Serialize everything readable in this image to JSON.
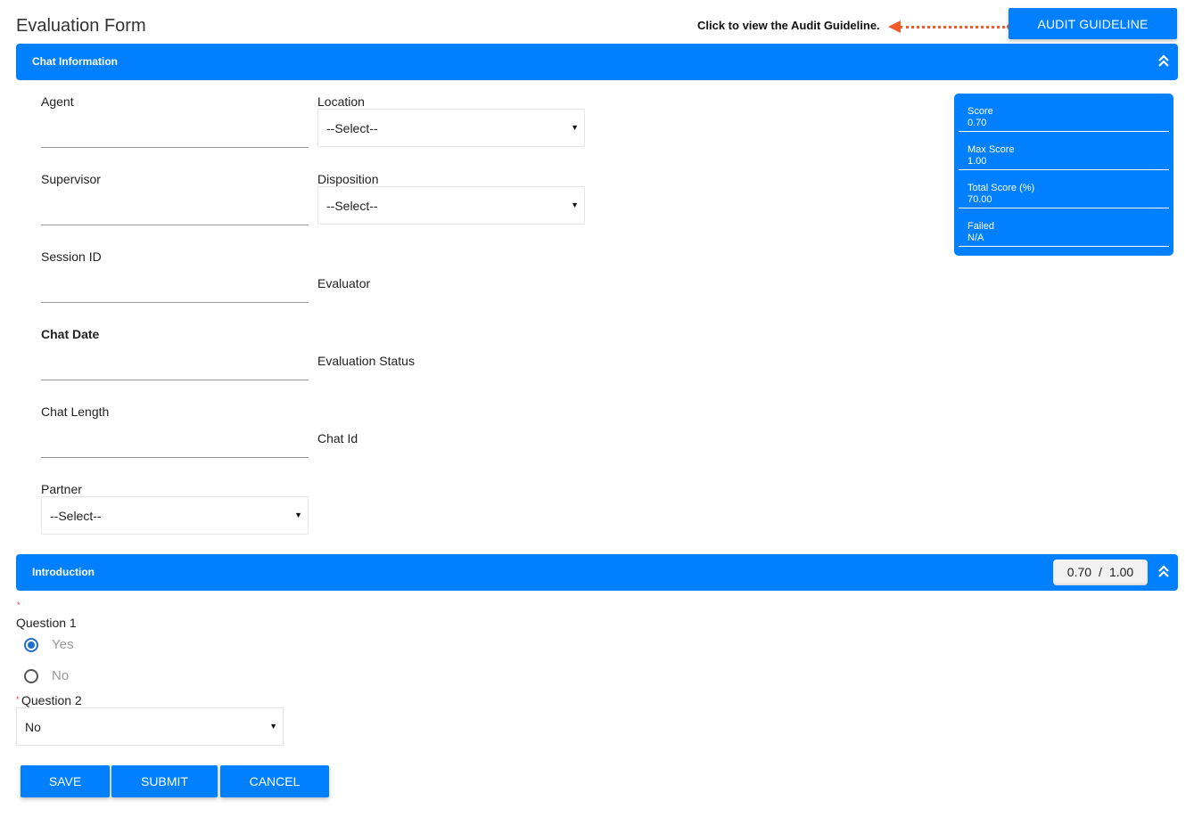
{
  "page": {
    "title": "Evaluation Form",
    "hint_text": "Click to view the Audit Guideline.",
    "audit_button_label": "AUDIT GUIDELINE",
    "accent_color": "#0080ff",
    "hint_color": "#f05a28"
  },
  "chat_information": {
    "title": "Chat Information",
    "left_fields": [
      {
        "label": "Agent",
        "value": ""
      },
      {
        "label": "Supervisor",
        "value": ""
      },
      {
        "label": "Session ID",
        "value": ""
      },
      {
        "label": "Chat Date",
        "value": ""
      },
      {
        "label": "Chat Length",
        "value": ""
      }
    ],
    "partner": {
      "label": "Partner",
      "value": "--Select--"
    },
    "location": {
      "label": "Location",
      "value": "--Select--"
    },
    "disposition": {
      "label": "Disposition",
      "value": "--Select--"
    },
    "evaluator": {
      "label": "Evaluator",
      "value": ""
    },
    "evaluation_status": {
      "label": "Evaluation Status",
      "value": ""
    },
    "chat_id": {
      "label": "Chat Id",
      "value": ""
    }
  },
  "score_card": [
    {
      "label": "Score",
      "value": "0.70"
    },
    {
      "label": "Max Score",
      "value": "1.00"
    },
    {
      "label": "Total Score (%)",
      "value": "70.00"
    },
    {
      "label": "Failed",
      "value": "N/A"
    }
  ],
  "introduction": {
    "title": "Introduction",
    "score": "0.70",
    "separator": "/",
    "max_score": "1.00",
    "question1": {
      "required_mark": "*",
      "label": "Question 1",
      "options": [
        {
          "label": "Yes",
          "checked": true
        },
        {
          "label": "No",
          "checked": false
        }
      ]
    },
    "question2": {
      "required_mark": "*",
      "label": "Question 2",
      "value": "No"
    }
  },
  "actions": {
    "save": "SAVE",
    "submit": "SUBMIT",
    "cancel": "CANCEL"
  },
  "icons": {
    "caret": "▼"
  }
}
